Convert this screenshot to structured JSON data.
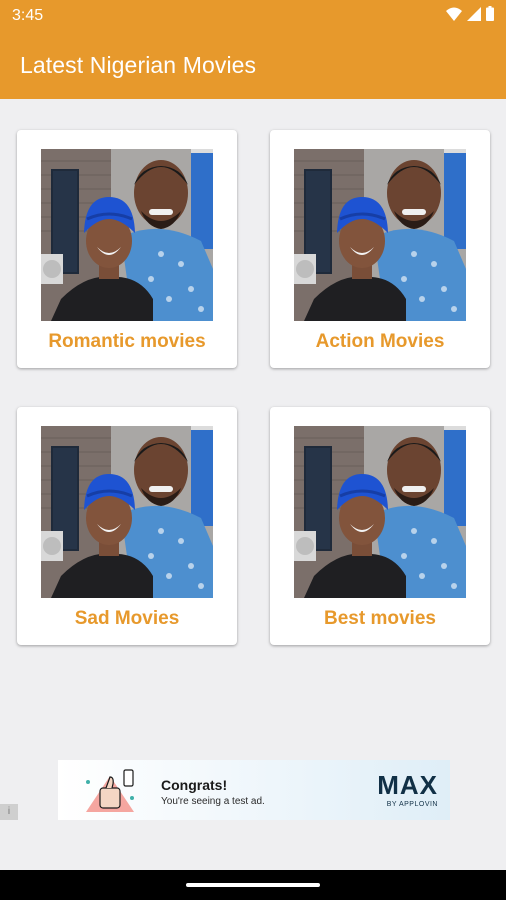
{
  "status_bar": {
    "time": "3:45"
  },
  "app_bar": {
    "title": "Latest Nigerian Movies"
  },
  "colors": {
    "accent": "#e7992c",
    "background": "#efeff1",
    "card": "#ffffff"
  },
  "categories": [
    {
      "label": "Romantic movies",
      "image": "couple-photo"
    },
    {
      "label": "Action Movies",
      "image": "couple-photo"
    },
    {
      "label": "Sad Movies",
      "image": "couple-photo"
    },
    {
      "label": "Best movies",
      "image": "couple-photo"
    }
  ],
  "ad": {
    "headline": "Congrats!",
    "subtext": "You're seeing a test ad.",
    "brand": "MAX",
    "brand_by": "BY APPLOVIN",
    "info_icon": "i"
  }
}
